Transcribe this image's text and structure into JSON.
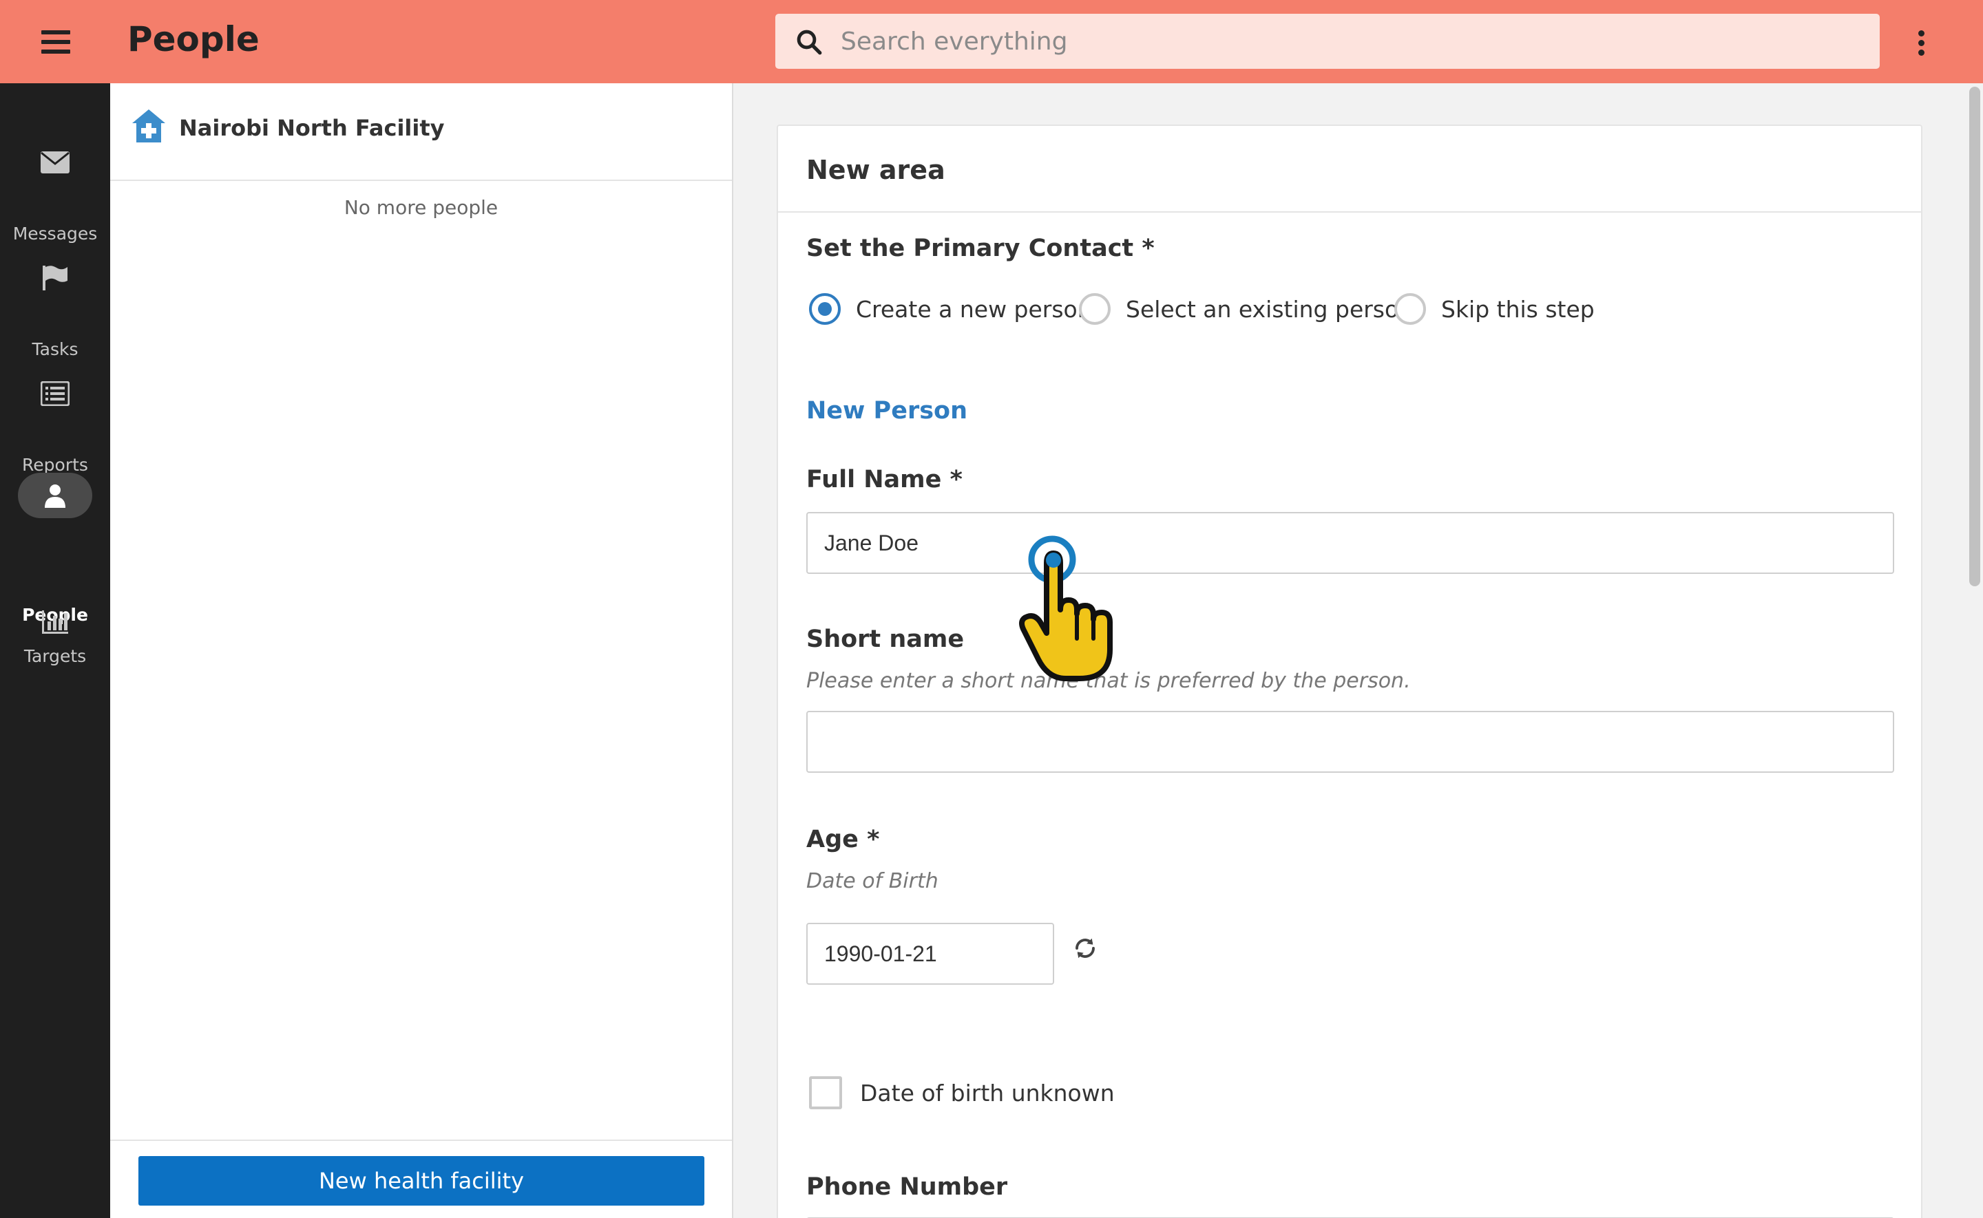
{
  "header": {
    "title": "People",
    "search_placeholder": "Search everything",
    "search_value": ""
  },
  "nav": {
    "items": [
      {
        "label": "Messages",
        "icon": "envelope-icon",
        "active": false
      },
      {
        "label": "Tasks",
        "icon": "flag-icon",
        "active": false
      },
      {
        "label": "Reports",
        "icon": "list-icon",
        "active": false
      },
      {
        "label": "People",
        "icon": "person-icon",
        "active": true
      },
      {
        "label": "Targets",
        "icon": "bar-chart-icon",
        "active": false
      }
    ]
  },
  "list_panel": {
    "facility_name": "Nairobi North Facility",
    "facility_icon": "health-facility-icon",
    "empty_text": "No more people",
    "new_button_label": "New health facility"
  },
  "form": {
    "title": "New area",
    "primary_contact": {
      "label": "Set the Primary Contact *",
      "options": [
        "Create a new person",
        "Select an existing person",
        "Skip this step"
      ],
      "selected": "Create a new person"
    },
    "section_title": "New Person",
    "full_name": {
      "label": "Full Name *",
      "value": "Jane Doe"
    },
    "short_name": {
      "label": "Short name",
      "hint": "Please enter a short name that is preferred by the person.",
      "value": ""
    },
    "age": {
      "label": "Age *",
      "hint": "Date of Birth",
      "value": "1990-01-21"
    },
    "dob_unknown": {
      "label": "Date of birth unknown",
      "checked": false
    },
    "phone": {
      "label": "Phone Number"
    }
  },
  "colors": {
    "header_bg": "#f47e6b",
    "nav_bg": "#1f1f1f",
    "accent": "#2f7cc0",
    "primary_button": "#0c71c3",
    "pointer_fill": "#f0c419"
  }
}
